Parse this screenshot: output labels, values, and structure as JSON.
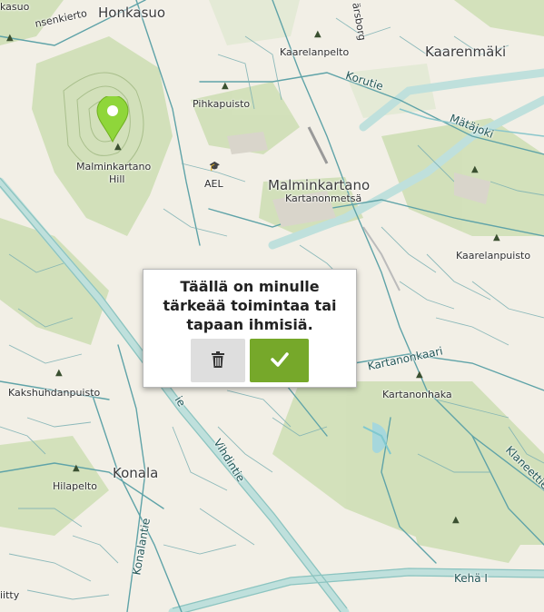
{
  "map_labels": {
    "kasuo": "kasuo",
    "honkasuo": "Honkasuo",
    "nsenkierto": "nsenkierto",
    "malminkartano_hill_line1": "Malminkartano",
    "malminkartano_hill_line2": "Hill",
    "pihkapuisto": "Pihkapuisto",
    "kaarelanpelto": "Kaarelanpelto",
    "korutie": "Korutie",
    "kaarenmaki": "Kaarenmäki",
    "matajoki": "Mätäjoki",
    "arsborg": "ärsborg",
    "ael": "AEL",
    "malminkartano": "Malminkartano",
    "kartanonmetsa": "Kartanonmetsä",
    "kaarelanpuisto": "Kaarelanpuisto",
    "kartanonkaari": "Kartanonkaari",
    "kartanonhaka": "Kartanonhaka",
    "kakshuhdanpuisto": "Kakshuhdanpuisto",
    "vihdintie": "Vihdintie",
    "vihdintie_partial": "ie",
    "konala": "Konala",
    "hilapelto": "Hilapelto",
    "konalantie": "Konalantie",
    "klaneettie": "Klaneettie",
    "keha_i": "Kehä I",
    "iitty": "iitty"
  },
  "popup": {
    "text": "Täällä on minulle tärkeää toimintaa tai tapaan ihmisiä.",
    "delete_icon": "trash-icon",
    "confirm_icon": "check-icon",
    "confirm_color": "#76a82a",
    "delete_color": "#dedede"
  },
  "marker": {
    "icon": "map-pin-icon",
    "color": "#8fd63a"
  }
}
